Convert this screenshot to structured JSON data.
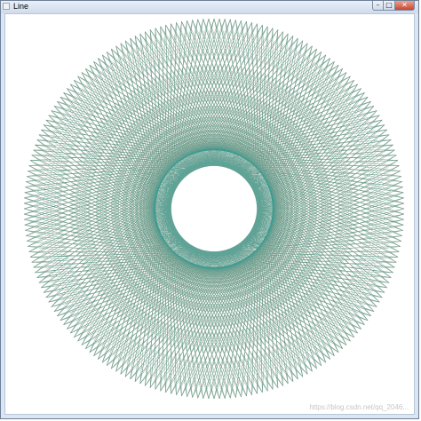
{
  "window": {
    "title": "Line",
    "controls": {
      "minimize": "–",
      "maximize": "□",
      "close": "✕"
    }
  },
  "canvas": {
    "icon": "spirograph-pattern",
    "colors": {
      "teal": "#2a9c96",
      "salmon": "#ff9d78"
    }
  },
  "watermark": "https://blog.csdn.net/qq_2046..."
}
